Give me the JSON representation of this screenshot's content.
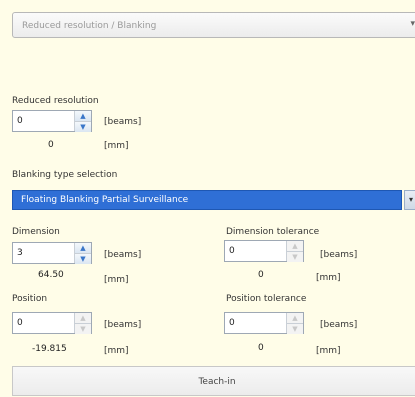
{
  "header": {
    "title": "Reduced resolution / Blanking",
    "arrow": "▾"
  },
  "reduced": {
    "label": "Reduced resolution",
    "value": "0",
    "unit_beams": "[beams]",
    "mm_value": "0",
    "unit_mm": "[mm]"
  },
  "blanking": {
    "label": "Blanking type selection",
    "selected": "Floating Blanking Partial Surveillance",
    "arrow": "▾"
  },
  "dimension": {
    "label": "Dimension",
    "value": "3",
    "unit_beams": "[beams]",
    "mm_value": "64.50",
    "unit_mm": "[mm]"
  },
  "dimension_tol": {
    "label": "Dimension tolerance",
    "value": "0",
    "unit_beams": "[beams]",
    "mm_value": "0",
    "unit_mm": "[mm]"
  },
  "position": {
    "label": "Position",
    "value": "0",
    "unit_beams": "[beams]",
    "mm_value": "-19.815",
    "unit_mm": "[mm]"
  },
  "position_tol": {
    "label": "Position tolerance",
    "value": "0",
    "unit_beams": "[beams]",
    "mm_value": "0",
    "unit_mm": "[mm]"
  },
  "spin_up": "▲",
  "spin_down": "▼",
  "teach_in": "Teach-in"
}
